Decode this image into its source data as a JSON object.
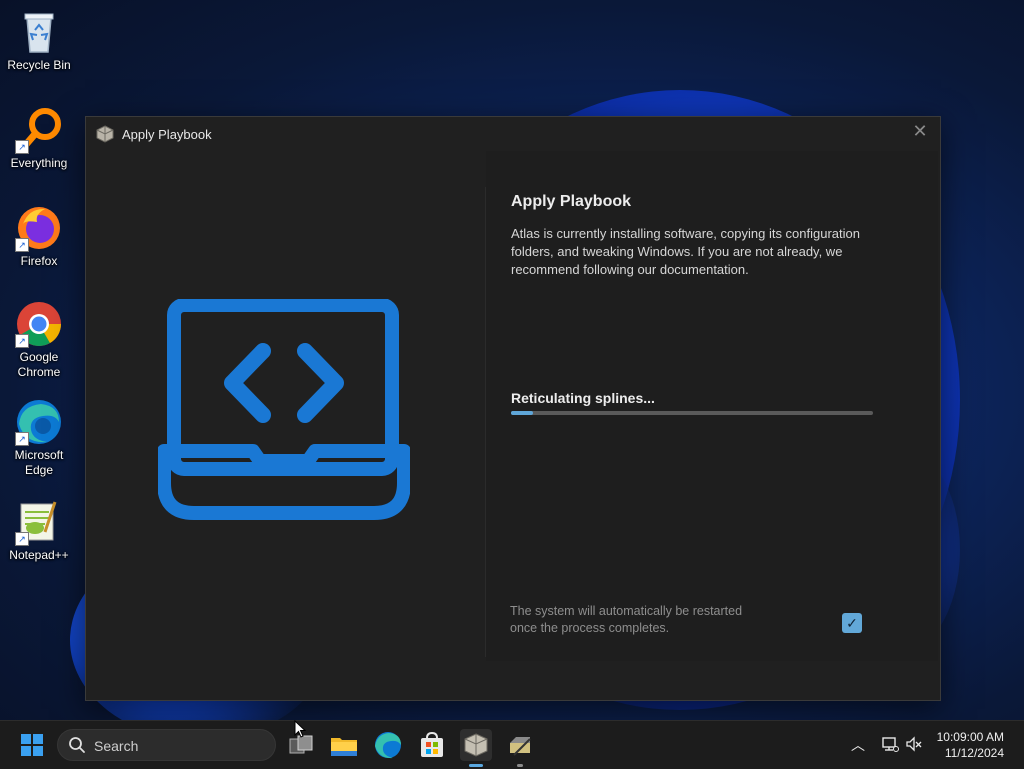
{
  "desktop": {
    "icons": [
      {
        "name": "Recycle Bin"
      },
      {
        "name": "Everything"
      },
      {
        "name": "Firefox"
      },
      {
        "name": "Google Chrome"
      },
      {
        "name": "Microsoft Edge"
      },
      {
        "name": "Notepad++"
      }
    ]
  },
  "window": {
    "title": "Apply Playbook",
    "close_icon": "close-icon",
    "heading": "Apply Playbook",
    "description": "Atlas is currently installing software, copying its configuration folders, and tweaking Windows. If you are not already, we recommend following our documentation.",
    "status": "Reticulating splines...",
    "progress_fraction": 0.06,
    "restart_note": "The system will automatically be restarted once the process completes.",
    "restart_checked": true,
    "illustration_icon": "laptop-code-icon",
    "accent_color": "#1a78d4"
  },
  "taskbar": {
    "search_placeholder": "Search",
    "apps": [
      "start-icon",
      "task-view-icon",
      "file-explorer-icon",
      "edge-icon",
      "store-icon",
      "atlas-playbook-icon",
      "ame-wizard-icon"
    ],
    "time": "10:09:00 AM",
    "date": "11/12/2024"
  }
}
